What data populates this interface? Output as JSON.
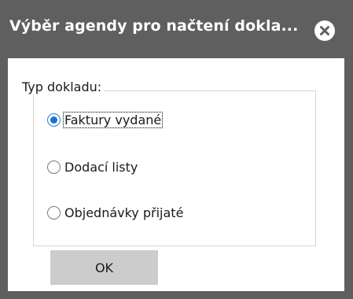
{
  "window": {
    "title": "Výběr agendy pro načtení dokla...",
    "close_icon": "close-circle-icon",
    "titlebar_color": "#5f5f5f"
  },
  "group": {
    "legend": "Typ dokladu:",
    "options": [
      {
        "label": "Faktury vydané",
        "checked": true
      },
      {
        "label": "Dodací listy",
        "checked": false
      },
      {
        "label": "Objednávky přijaté",
        "checked": false
      }
    ]
  },
  "buttons": {
    "ok_label": "OK"
  }
}
